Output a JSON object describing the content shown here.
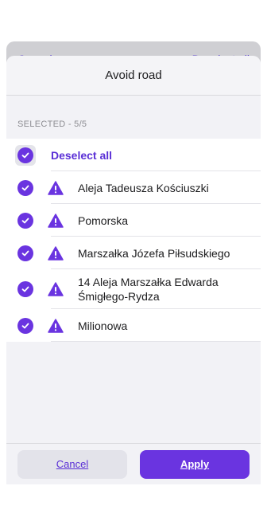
{
  "background": {
    "left_label": "Cancel",
    "right_label": "Deselect all"
  },
  "sheet": {
    "title": "Avoid road",
    "section_label": "SELECTED - 5/5",
    "deselect_all_label": "Deselect all",
    "roads": [
      {
        "name": "Aleja Tadeusza Kościuszki",
        "checked": true,
        "icon": "warning-icon"
      },
      {
        "name": "Pomorska",
        "checked": true,
        "icon": "warning-icon"
      },
      {
        "name": "Marszałka Józefa Piłsudskiego",
        "checked": true,
        "icon": "warning-icon"
      },
      {
        "name": "14 Aleja Marszałka Edwarda Śmigłego-Rydza",
        "checked": true,
        "icon": "warning-icon"
      },
      {
        "name": "Milionowa",
        "checked": true,
        "icon": "warning-icon"
      }
    ],
    "cancel_label": "Cancel",
    "apply_label": "Apply"
  },
  "colors": {
    "accent": "#6a34e0",
    "accent_text": "#5a2fd6",
    "sheet_bg": "#f2f2f6"
  }
}
